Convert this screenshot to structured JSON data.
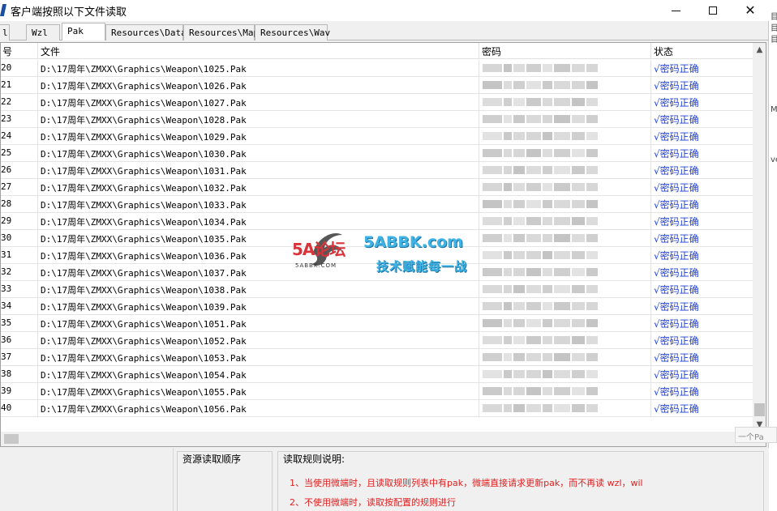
{
  "window": {
    "title": "客户端按照以下文件读取",
    "controls": {
      "minimize": "—",
      "maximize": "☐",
      "close": "✕"
    }
  },
  "tabs": [
    {
      "label": "l",
      "active": false
    },
    {
      "label": "Wzl",
      "active": false
    },
    {
      "label": "Pak",
      "active": true
    },
    {
      "label": "Resources\\Data",
      "active": false
    },
    {
      "label": "Resources\\Map",
      "active": false
    },
    {
      "label": "Resources\\Wav",
      "active": false
    }
  ],
  "table": {
    "columns": {
      "no": "号",
      "file": "文件",
      "password": "密码",
      "status": "状态"
    },
    "rows": [
      {
        "no": "20",
        "file": "D:\\17周年\\ZMXX\\Graphics\\Weapon\\1025.Pak",
        "status": "√密码正确"
      },
      {
        "no": "21",
        "file": "D:\\17周年\\ZMXX\\Graphics\\Weapon\\1026.Pak",
        "status": "√密码正确"
      },
      {
        "no": "22",
        "file": "D:\\17周年\\ZMXX\\Graphics\\Weapon\\1027.Pak",
        "status": "√密码正确"
      },
      {
        "no": "23",
        "file": "D:\\17周年\\ZMXX\\Graphics\\Weapon\\1028.Pak",
        "status": "√密码正确"
      },
      {
        "no": "24",
        "file": "D:\\17周年\\ZMXX\\Graphics\\Weapon\\1029.Pak",
        "status": "√密码正确"
      },
      {
        "no": "25",
        "file": "D:\\17周年\\ZMXX\\Graphics\\Weapon\\1030.Pak",
        "status": "√密码正确"
      },
      {
        "no": "26",
        "file": "D:\\17周年\\ZMXX\\Graphics\\Weapon\\1031.Pak",
        "status": "√密码正确"
      },
      {
        "no": "27",
        "file": "D:\\17周年\\ZMXX\\Graphics\\Weapon\\1032.Pak",
        "status": "√密码正确"
      },
      {
        "no": "28",
        "file": "D:\\17周年\\ZMXX\\Graphics\\Weapon\\1033.Pak",
        "status": "√密码正确"
      },
      {
        "no": "29",
        "file": "D:\\17周年\\ZMXX\\Graphics\\Weapon\\1034.Pak",
        "status": "√密码正确"
      },
      {
        "no": "30",
        "file": "D:\\17周年\\ZMXX\\Graphics\\Weapon\\1035.Pak",
        "status": "√密码正确"
      },
      {
        "no": "31",
        "file": "D:\\17周年\\ZMXX\\Graphics\\Weapon\\1036.Pak",
        "status": "√密码正确"
      },
      {
        "no": "32",
        "file": "D:\\17周年\\ZMXX\\Graphics\\Weapon\\1037.Pak",
        "status": "√密码正确"
      },
      {
        "no": "33",
        "file": "D:\\17周年\\ZMXX\\Graphics\\Weapon\\1038.Pak",
        "status": "√密码正确"
      },
      {
        "no": "34",
        "file": "D:\\17周年\\ZMXX\\Graphics\\Weapon\\1039.Pak",
        "status": "√密码正确"
      },
      {
        "no": "35",
        "file": "D:\\17周年\\ZMXX\\Graphics\\Weapon\\1051.Pak",
        "status": "√密码正确"
      },
      {
        "no": "36",
        "file": "D:\\17周年\\ZMXX\\Graphics\\Weapon\\1052.Pak",
        "status": "√密码正确"
      },
      {
        "no": "37",
        "file": "D:\\17周年\\ZMXX\\Graphics\\Weapon\\1053.Pak",
        "status": "√密码正确"
      },
      {
        "no": "38",
        "file": "D:\\17周年\\ZMXX\\Graphics\\Weapon\\1054.Pak",
        "status": "√密码正确"
      },
      {
        "no": "39",
        "file": "D:\\17周年\\ZMXX\\Graphics\\Weapon\\1055.Pak",
        "status": "√密码正确"
      },
      {
        "no": "40",
        "file": "D:\\17周年\\ZMXX\\Graphics\\Weapon\\1056.Pak",
        "status": "√密码正确"
      }
    ]
  },
  "bottom": {
    "order_group_title": "资源读取顺序",
    "rules_group_title": "读取规则说明:",
    "rules": [
      "1、当使用微端时，且读取规则列表中有pak，微端直接请求更新pak，而不再读 wzl，wil",
      "2、不使用微端时，读取按配置的规则进行"
    ]
  },
  "hint_tooltip": "一个Pa",
  "background_fragments": [
    "目",
    "目",
    "目",
    "M",
    "ve"
  ],
  "watermark": {
    "logo": "5A论坛",
    "logo_sub": "5ABBK.COM",
    "domain": "5ABBK.com",
    "slogan": "技术赋能每一战"
  },
  "colors": {
    "status_ok": "#1f3fd6",
    "rule_text": "#e02020",
    "watermark_blue": "#3fb3e4",
    "watermark_red": "#d8343a"
  }
}
